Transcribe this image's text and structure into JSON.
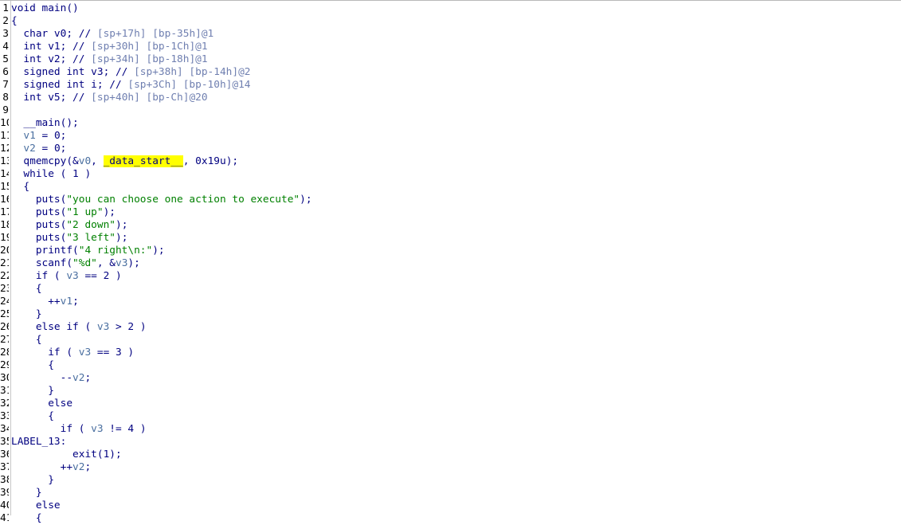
{
  "window": {
    "title": ""
  },
  "highlight_color": "#ffff00",
  "lines": [
    {
      "n": "1",
      "tokens": [
        {
          "t": "void main()",
          "c": "pl"
        }
      ]
    },
    {
      "n": "2",
      "tokens": [
        {
          "t": "{",
          "c": "pl"
        }
      ]
    },
    {
      "n": "3",
      "tokens": [
        {
          "t": "  char v0; // ",
          "c": "pl"
        },
        {
          "t": "[sp+17h] [bp-35h]@1",
          "c": "cmt"
        }
      ]
    },
    {
      "n": "4",
      "tokens": [
        {
          "t": "  int v1; // ",
          "c": "pl"
        },
        {
          "t": "[sp+30h] [bp-1Ch]@1",
          "c": "cmt"
        }
      ]
    },
    {
      "n": "5",
      "tokens": [
        {
          "t": "  int v2; // ",
          "c": "pl"
        },
        {
          "t": "[sp+34h] [bp-18h]@1",
          "c": "cmt"
        }
      ]
    },
    {
      "n": "6",
      "tokens": [
        {
          "t": "  signed int v3; // ",
          "c": "pl"
        },
        {
          "t": "[sp+38h] [bp-14h]@2",
          "c": "cmt"
        }
      ]
    },
    {
      "n": "7",
      "tokens": [
        {
          "t": "  signed int i; // ",
          "c": "pl"
        },
        {
          "t": "[sp+3Ch] [bp-10h]@14",
          "c": "cmt"
        }
      ]
    },
    {
      "n": "8",
      "tokens": [
        {
          "t": "  int v5; // ",
          "c": "pl"
        },
        {
          "t": "[sp+40h] [bp-Ch]@20",
          "c": "cmt"
        }
      ]
    },
    {
      "n": "9",
      "tokens": []
    },
    {
      "n": "10",
      "tokens": [
        {
          "t": "  __main();",
          "c": "pl"
        }
      ]
    },
    {
      "n": "11",
      "tokens": [
        {
          "t": "  ",
          "c": "pl"
        },
        {
          "t": "v1",
          "c": "var"
        },
        {
          "t": " = 0;",
          "c": "pl"
        }
      ]
    },
    {
      "n": "12",
      "tokens": [
        {
          "t": "  ",
          "c": "pl"
        },
        {
          "t": "v2",
          "c": "var"
        },
        {
          "t": " = 0;",
          "c": "pl"
        }
      ]
    },
    {
      "n": "13",
      "tokens": [
        {
          "t": "  qmemcpy(&",
          "c": "pl"
        },
        {
          "t": "v0",
          "c": "var"
        },
        {
          "t": ", ",
          "c": "pl"
        },
        {
          "t": "_data_start__",
          "c": "hl"
        },
        {
          "t": ", 0x19u);",
          "c": "pl"
        }
      ]
    },
    {
      "n": "14",
      "tokens": [
        {
          "t": "  while ( 1 )",
          "c": "pl"
        }
      ]
    },
    {
      "n": "15",
      "tokens": [
        {
          "t": "  {",
          "c": "pl"
        }
      ]
    },
    {
      "n": "16",
      "tokens": [
        {
          "t": "    puts(",
          "c": "pl"
        },
        {
          "t": "\"you can choose one action to execute\"",
          "c": "str"
        },
        {
          "t": ");",
          "c": "pl"
        }
      ]
    },
    {
      "n": "17",
      "tokens": [
        {
          "t": "    puts(",
          "c": "pl"
        },
        {
          "t": "\"1 up\"",
          "c": "str"
        },
        {
          "t": ");",
          "c": "pl"
        }
      ]
    },
    {
      "n": "18",
      "tokens": [
        {
          "t": "    puts(",
          "c": "pl"
        },
        {
          "t": "\"2 down\"",
          "c": "str"
        },
        {
          "t": ");",
          "c": "pl"
        }
      ]
    },
    {
      "n": "19",
      "tokens": [
        {
          "t": "    puts(",
          "c": "pl"
        },
        {
          "t": "\"3 left\"",
          "c": "str"
        },
        {
          "t": ");",
          "c": "pl"
        }
      ]
    },
    {
      "n": "20",
      "tokens": [
        {
          "t": "    printf(",
          "c": "pl"
        },
        {
          "t": "\"4 right\\n:\"",
          "c": "str"
        },
        {
          "t": ");",
          "c": "pl"
        }
      ]
    },
    {
      "n": "21",
      "tokens": [
        {
          "t": "    scanf(",
          "c": "pl"
        },
        {
          "t": "\"%d\"",
          "c": "str"
        },
        {
          "t": ", &",
          "c": "pl"
        },
        {
          "t": "v3",
          "c": "var"
        },
        {
          "t": ");",
          "c": "pl"
        }
      ]
    },
    {
      "n": "22",
      "tokens": [
        {
          "t": "    if ( ",
          "c": "pl"
        },
        {
          "t": "v3",
          "c": "var"
        },
        {
          "t": " == 2 )",
          "c": "pl"
        }
      ]
    },
    {
      "n": "23",
      "tokens": [
        {
          "t": "    {",
          "c": "pl"
        }
      ]
    },
    {
      "n": "24",
      "tokens": [
        {
          "t": "      ++",
          "c": "pl"
        },
        {
          "t": "v1",
          "c": "var"
        },
        {
          "t": ";",
          "c": "pl"
        }
      ]
    },
    {
      "n": "25",
      "tokens": [
        {
          "t": "    }",
          "c": "pl"
        }
      ]
    },
    {
      "n": "26",
      "tokens": [
        {
          "t": "    else if ( ",
          "c": "pl"
        },
        {
          "t": "v3",
          "c": "var"
        },
        {
          "t": " > 2 )",
          "c": "pl"
        }
      ]
    },
    {
      "n": "27",
      "tokens": [
        {
          "t": "    {",
          "c": "pl"
        }
      ]
    },
    {
      "n": "28",
      "tokens": [
        {
          "t": "      if ( ",
          "c": "pl"
        },
        {
          "t": "v3",
          "c": "var"
        },
        {
          "t": " == 3 )",
          "c": "pl"
        }
      ]
    },
    {
      "n": "29",
      "tokens": [
        {
          "t": "      {",
          "c": "pl"
        }
      ]
    },
    {
      "n": "30",
      "tokens": [
        {
          "t": "        --",
          "c": "pl"
        },
        {
          "t": "v2",
          "c": "var"
        },
        {
          "t": ";",
          "c": "pl"
        }
      ]
    },
    {
      "n": "31",
      "tokens": [
        {
          "t": "      }",
          "c": "pl"
        }
      ]
    },
    {
      "n": "32",
      "tokens": [
        {
          "t": "      else",
          "c": "pl"
        }
      ]
    },
    {
      "n": "33",
      "tokens": [
        {
          "t": "      {",
          "c": "pl"
        }
      ]
    },
    {
      "n": "34",
      "tokens": [
        {
          "t": "        if ( ",
          "c": "pl"
        },
        {
          "t": "v3",
          "c": "var"
        },
        {
          "t": " != 4 )",
          "c": "pl"
        }
      ]
    },
    {
      "n": "35",
      "tokens": [
        {
          "t": "LABEL_13:",
          "c": "pl"
        }
      ]
    },
    {
      "n": "36",
      "tokens": [
        {
          "t": "          exit(1);",
          "c": "pl"
        }
      ]
    },
    {
      "n": "37",
      "tokens": [
        {
          "t": "        ++",
          "c": "pl"
        },
        {
          "t": "v2",
          "c": "var"
        },
        {
          "t": ";",
          "c": "pl"
        }
      ]
    },
    {
      "n": "38",
      "tokens": [
        {
          "t": "      }",
          "c": "pl"
        }
      ]
    },
    {
      "n": "39",
      "tokens": [
        {
          "t": "    }",
          "c": "pl"
        }
      ]
    },
    {
      "n": "40",
      "tokens": [
        {
          "t": "    else",
          "c": "pl"
        }
      ]
    },
    {
      "n": "41",
      "tokens": [
        {
          "t": "    {",
          "c": "pl"
        }
      ]
    }
  ]
}
